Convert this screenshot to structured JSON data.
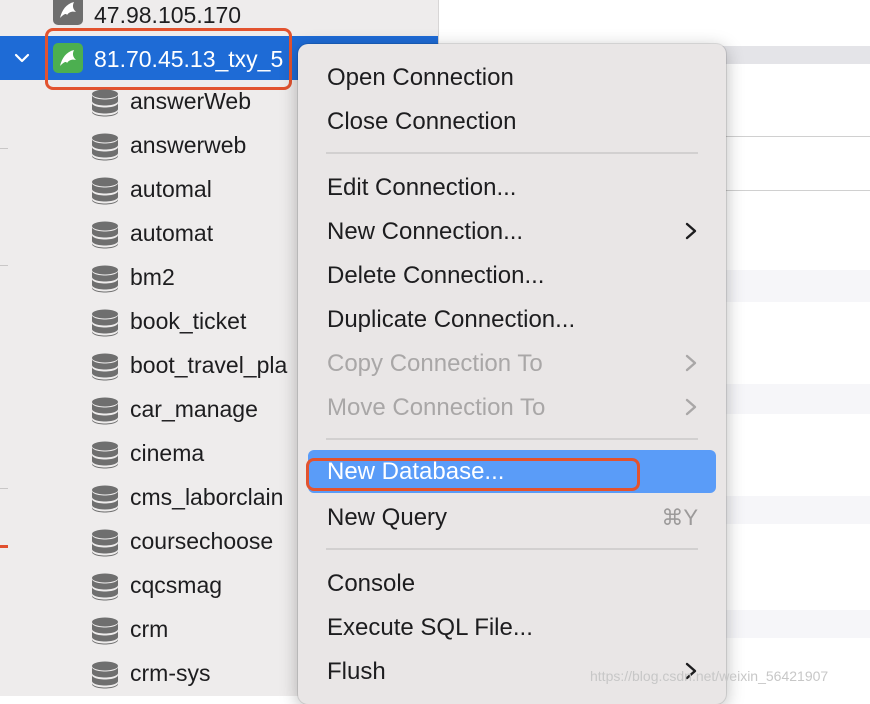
{
  "sidebar": {
    "connections": [
      {
        "label": "47.98.105.170",
        "icon": "mysql-dolphin-icon",
        "state": "collapsed"
      },
      {
        "label": "81.70.45.13_txy_5",
        "icon": "mysql-dolphin-icon",
        "state": "expanded",
        "selected": true
      }
    ],
    "databases": [
      "answerWeb",
      "answerweb",
      "automal",
      "automat",
      "bm2",
      "book_ticket",
      "boot_travel_pla",
      "car_manage",
      "cinema",
      "cms_laborclain",
      "coursechoose",
      "cqcsmag",
      "crm",
      "crm-sys"
    ]
  },
  "context_menu": {
    "groups": [
      [
        {
          "label": "Open Connection",
          "enabled": true
        },
        {
          "label": "Close Connection",
          "enabled": true
        }
      ],
      [
        {
          "label": "Edit Connection...",
          "enabled": true
        },
        {
          "label": "New Connection...",
          "enabled": true,
          "submenu": true
        },
        {
          "label": "Delete Connection...",
          "enabled": true
        },
        {
          "label": "Duplicate Connection...",
          "enabled": true
        },
        {
          "label": "Copy Connection To",
          "enabled": false,
          "submenu": true
        },
        {
          "label": "Move Connection To",
          "enabled": false,
          "submenu": true
        }
      ],
      [
        {
          "label": "New Database...",
          "enabled": true,
          "highlighted": true
        },
        {
          "label": "New Query",
          "enabled": true,
          "shortcut": "⌘Y"
        }
      ],
      [
        {
          "label": "Console",
          "enabled": true
        },
        {
          "label": "Execute SQL File...",
          "enabled": true
        },
        {
          "label": "Flush",
          "enabled": true,
          "submenu": true
        }
      ]
    ]
  },
  "watermark": "https://blog.csdn.net/weixin_56421907",
  "colors": {
    "selection": "#1e6bd6",
    "menu_highlight": "#5a9cf8",
    "annotation_red": "#e2532f",
    "mysql_green": "#4caf50"
  }
}
